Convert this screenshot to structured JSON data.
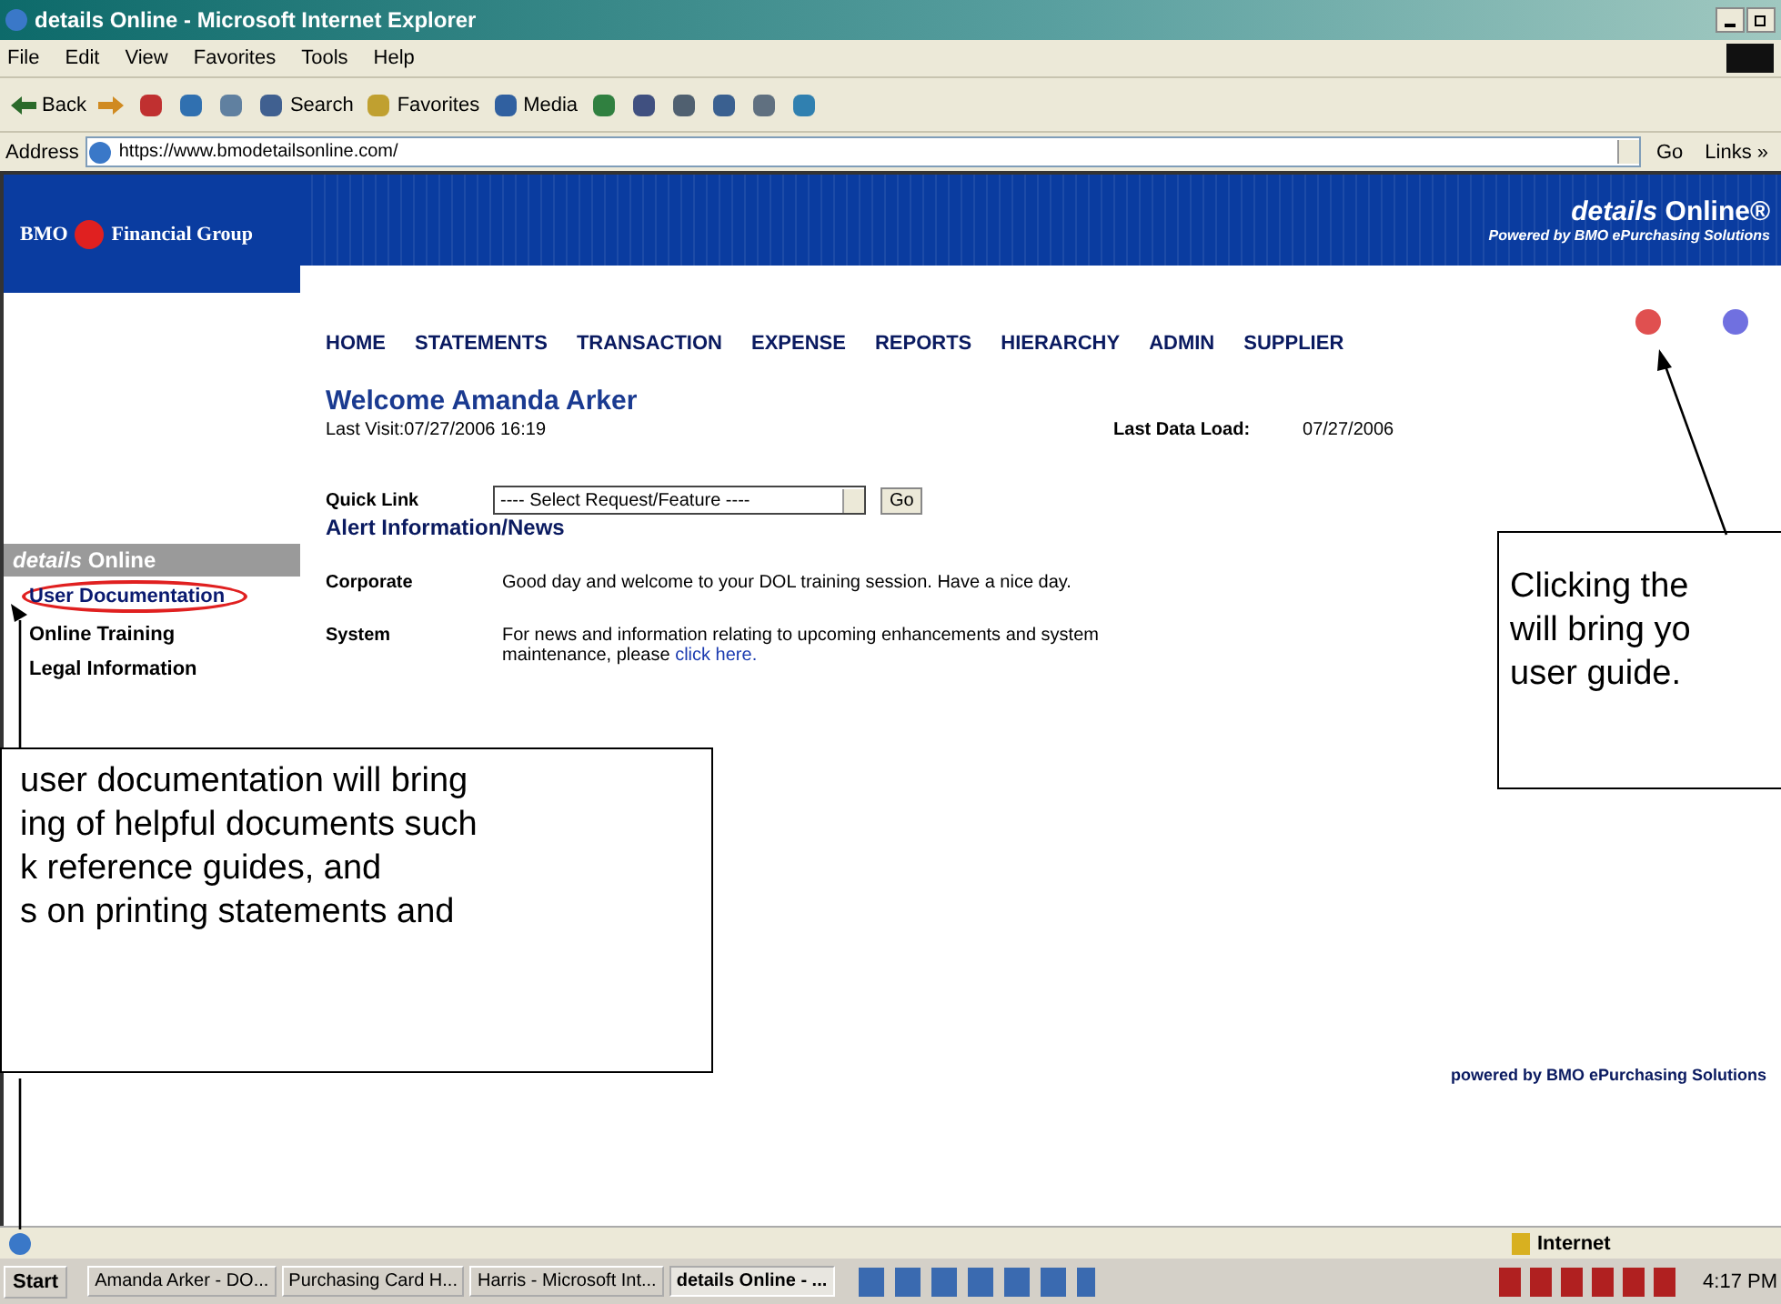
{
  "window": {
    "title": "details Online - Microsoft Internet Explorer"
  },
  "menu": [
    "File",
    "Edit",
    "View",
    "Favorites",
    "Tools",
    "Help"
  ],
  "toolbar": [
    {
      "kind": "back",
      "label": "Back"
    },
    {
      "kind": "forward"
    },
    {
      "kind": "stop"
    },
    {
      "kind": "refresh"
    },
    {
      "kind": "home"
    },
    {
      "kind": "search",
      "label": "Search"
    },
    {
      "kind": "favorites",
      "label": "Favorites"
    },
    {
      "kind": "media",
      "label": "Media"
    },
    {
      "kind": "history"
    },
    {
      "kind": "mail"
    },
    {
      "kind": "print"
    },
    {
      "kind": "edit"
    },
    {
      "kind": "doc"
    },
    {
      "kind": "messenger"
    }
  ],
  "address": {
    "label": "Address",
    "value": "https://www.bmodetailsonline.com/",
    "go": "Go",
    "links": "Links »"
  },
  "banner": {
    "brand_left": "BMO",
    "brand_right": "Financial Group",
    "product_italic": "details",
    "product": "Online®",
    "tagline": "Powered by BMO ePurchasing Solutions"
  },
  "nav": [
    "HOME",
    "STATEMENTS",
    "TRANSACTION",
    "EXPENSE",
    "REPORTS",
    "HIERARCHY",
    "ADMIN",
    "SUPPLIER"
  ],
  "welcome": {
    "title": "Welcome Amanda Arker",
    "last_visit": "Last Visit:07/27/2006 16:19",
    "last_load_label": "Last Data Load:",
    "last_load": "07/27/2006"
  },
  "quick_link": {
    "label": "Quick Link",
    "value": "---- Select Request/Feature ----",
    "button": "Go"
  },
  "sidebar": {
    "title": "**details** Online",
    "items": [
      {
        "label": "User Documentation",
        "circled": true
      },
      {
        "label": "Online Training",
        "circled": false
      },
      {
        "label": "Legal Information",
        "circled": false
      }
    ]
  },
  "alerts": {
    "title": "Alert Information/News",
    "rows": [
      {
        "name": "Corporate",
        "text": "Good day and welcome to your DOL training session. Have a nice day."
      },
      {
        "name": "System",
        "text": "For news and information relating to upcoming enhancements and system maintenance, please",
        "link": "click here."
      }
    ]
  },
  "footer": "powered by BMO ePurchasing Solutions",
  "callouts": [
    {
      "kind": "left",
      "lines": [
        "user documentation will bring",
        "ing of helpful documents such",
        "k reference guides, and",
        "s on printing statements and"
      ]
    },
    {
      "kind": "right",
      "lines": [
        "Clicking the",
        "will bring yo",
        "user guide."
      ]
    }
  ],
  "status_bar": {
    "zone": "Internet"
  },
  "taskbar": {
    "start": "Start",
    "tasks": [
      {
        "label": "Amanda Arker - DO...",
        "selected": false
      },
      {
        "label": "Purchasing Card H...",
        "selected": false
      },
      {
        "label": "Harris - Microsoft Int...",
        "selected": false
      },
      {
        "label": "details Online - ...",
        "selected": true
      }
    ],
    "clock": "4:17 PM"
  }
}
